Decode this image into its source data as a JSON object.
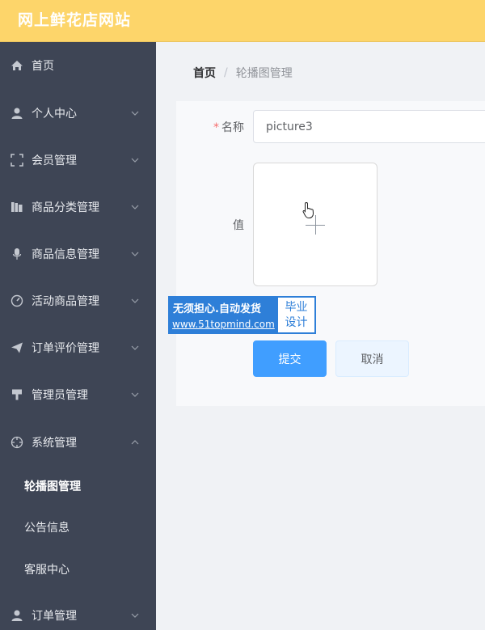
{
  "header": {
    "site_title": "网上鲜花店网站"
  },
  "sidebar": {
    "items": [
      {
        "label": "首页",
        "icon": "home-icon"
      },
      {
        "label": "个人中心",
        "icon": "user-icon"
      },
      {
        "label": "会员管理",
        "icon": "frame-icon"
      },
      {
        "label": "商品分类管理",
        "icon": "books-icon"
      },
      {
        "label": "商品信息管理",
        "icon": "microphone-icon"
      },
      {
        "label": "活动商品管理",
        "icon": "gauge-icon"
      },
      {
        "label": "订单评价管理",
        "icon": "send-icon"
      },
      {
        "label": "管理员管理",
        "icon": "brush-icon"
      },
      {
        "label": "系统管理",
        "icon": "crosshair-icon"
      },
      {
        "label": "订单管理",
        "icon": "user-icon"
      }
    ],
    "sub_items": [
      {
        "label": "轮播图管理"
      },
      {
        "label": "公告信息"
      },
      {
        "label": "客服中心"
      }
    ]
  },
  "breadcrumb": {
    "home": "首页",
    "separator": "/",
    "current": "轮播图管理"
  },
  "form": {
    "name_label": "名称",
    "required_mark": "*",
    "name_value": "picture3",
    "value_label": "值",
    "submit_label": "提交",
    "cancel_label": "取消"
  },
  "watermark": {
    "line1": "无须担心.自动发货",
    "line2": "www.51topmind.com",
    "right1": "毕业",
    "right2": "设计"
  },
  "colors": {
    "header": "#fdd56a",
    "sidebar": "#3e4555",
    "primary": "#409eff",
    "required": "#f56c6c"
  }
}
